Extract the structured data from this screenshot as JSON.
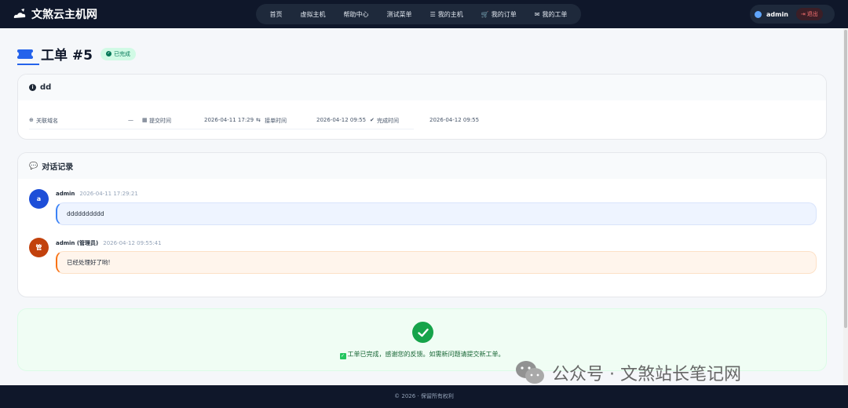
{
  "brand": {
    "name": "文煞云主机网"
  },
  "nav": [
    {
      "label": "首页",
      "icon": ""
    },
    {
      "label": "虚拟主机",
      "icon": ""
    },
    {
      "label": "帮助中心",
      "icon": ""
    },
    {
      "label": "测试菜单",
      "icon": ""
    },
    {
      "label": "我的主机",
      "icon": "server-icon"
    },
    {
      "label": "我的订单",
      "icon": "cart-icon"
    },
    {
      "label": "我的工单",
      "icon": "ticket-icon"
    }
  ],
  "user": {
    "name": "admin",
    "logout_label": "退出"
  },
  "ticket": {
    "title": "工单 #5",
    "status": "已完成",
    "status_color": "#047857",
    "subject": "dd",
    "meta": {
      "domain_label": "关联域名",
      "domain_value": "—",
      "submit_label": "提交时间",
      "submit_value": "2026-04-11 17:29",
      "accept_label": "接单时间",
      "accept_value": "2026-04-12 09:55",
      "done_label": "完成时间",
      "done_value": "2026-04-12 09:55"
    }
  },
  "conversation": {
    "title": "对话记录",
    "messages": [
      {
        "avatar": "a",
        "author": "admin",
        "time": "2026-04-11 17:29:21",
        "text": "dddddddddd",
        "color": "#1d4ed8"
      },
      {
        "avatar": "管",
        "author": "admin (管理员)",
        "time": "2026-04-12 09:55:41",
        "text": "已经处理好了哟!",
        "color": "#c2410c"
      }
    ]
  },
  "completion": {
    "text": "工单已完成，感谢您的反馈。如需新问题请提交新工单。"
  },
  "footer": {
    "text": "© 2026 · 保留所有权利"
  },
  "watermark": {
    "text": "公众号 · 文煞站长笔记网"
  }
}
